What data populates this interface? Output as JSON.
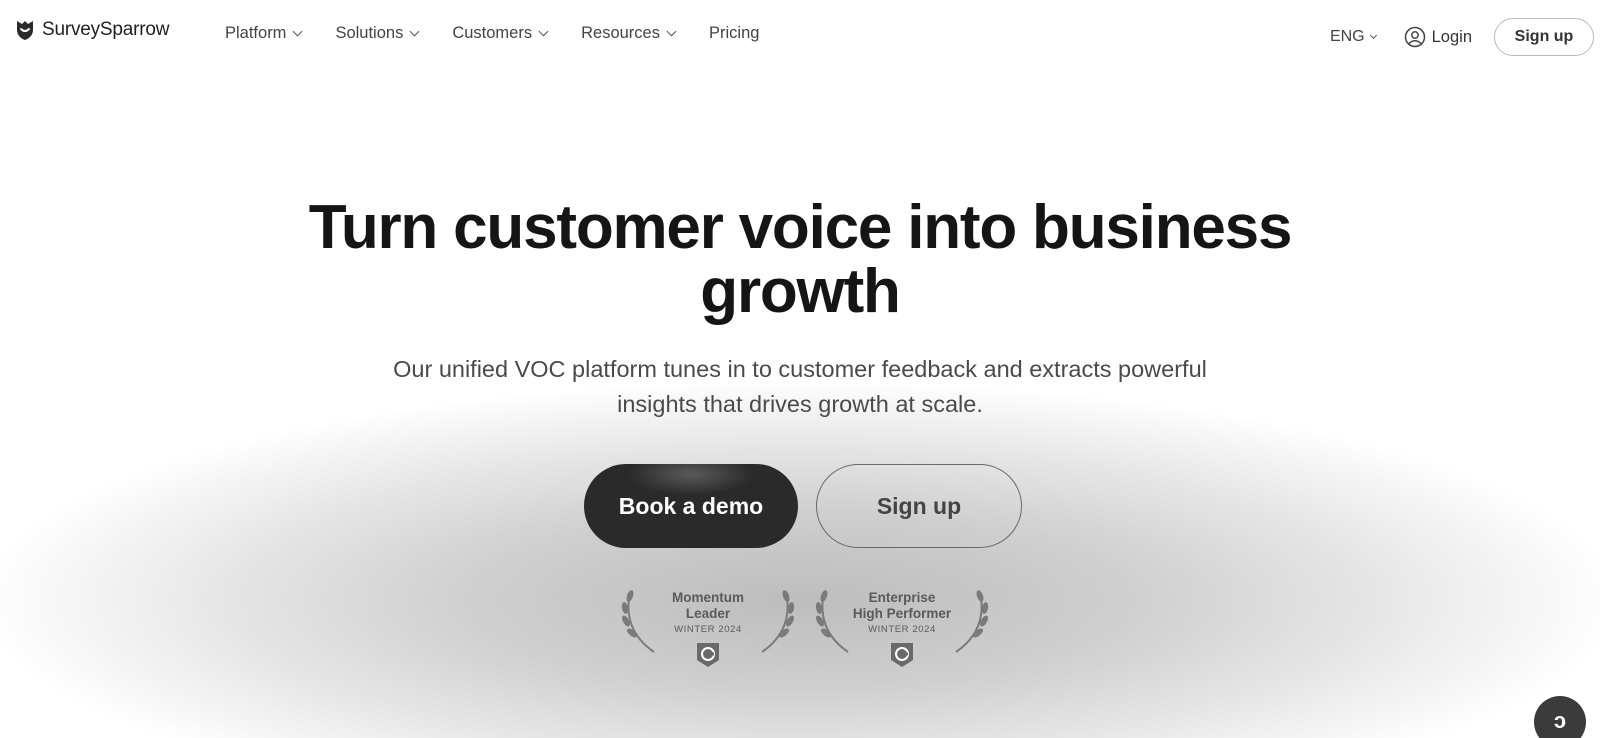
{
  "brand": {
    "name": "SurveySparrow",
    "logo_icon": "sparrow-heart-logo"
  },
  "nav": {
    "items": [
      {
        "label": "Platform",
        "has_dropdown": true
      },
      {
        "label": "Solutions",
        "has_dropdown": true
      },
      {
        "label": "Customers",
        "has_dropdown": true
      },
      {
        "label": "Resources",
        "has_dropdown": true
      },
      {
        "label": "Pricing",
        "has_dropdown": false
      }
    ],
    "language": "ENG",
    "login_label": "Login",
    "signup_label": "Sign up"
  },
  "hero": {
    "title_line1": "Turn customer voice into business",
    "title_line2": "growth",
    "subtitle_line1": "Our unified VOC platform tunes in to customer feedback and extracts powerful",
    "subtitle_line2": "insights that drives growth at scale.",
    "cta_primary": "Book a demo",
    "cta_secondary": "Sign up"
  },
  "badges": [
    {
      "line1": "Momentum",
      "line2": "Leader",
      "line3": "WINTER 2024",
      "icon": "g2-icon"
    },
    {
      "line1": "Enterprise",
      "line2": "High Performer",
      "line3": "WINTER 2024",
      "icon": "g2-icon"
    }
  ],
  "chat": {
    "icon": "chat-icon"
  },
  "colors": {
    "primary_button": "#2a2a2a",
    "text_dark": "#151515",
    "text_muted": "#4a4a4a"
  }
}
